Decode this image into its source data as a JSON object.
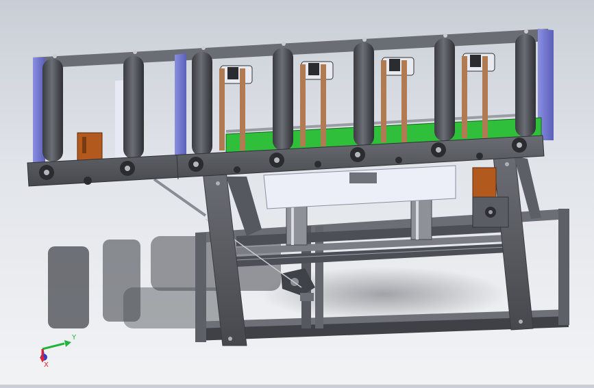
{
  "viewport": {
    "background_top": "#c9ced6",
    "background_bottom": "#f2f3f5"
  },
  "model": {
    "frame_color": "#5a5d63",
    "roller_color": "#4b4e54",
    "side_panel_color": "#6f74c9",
    "pcb_color": "#2fbf3a",
    "motor_color": "#b25a1e",
    "copper_color": "#b07a52",
    "plate_color": "#e8ebf4"
  },
  "triad": {
    "x_label": "X",
    "y_label": "Y",
    "x_color": "#e0242a",
    "y_color": "#22b33a",
    "z_color": "#2a3fd6"
  }
}
